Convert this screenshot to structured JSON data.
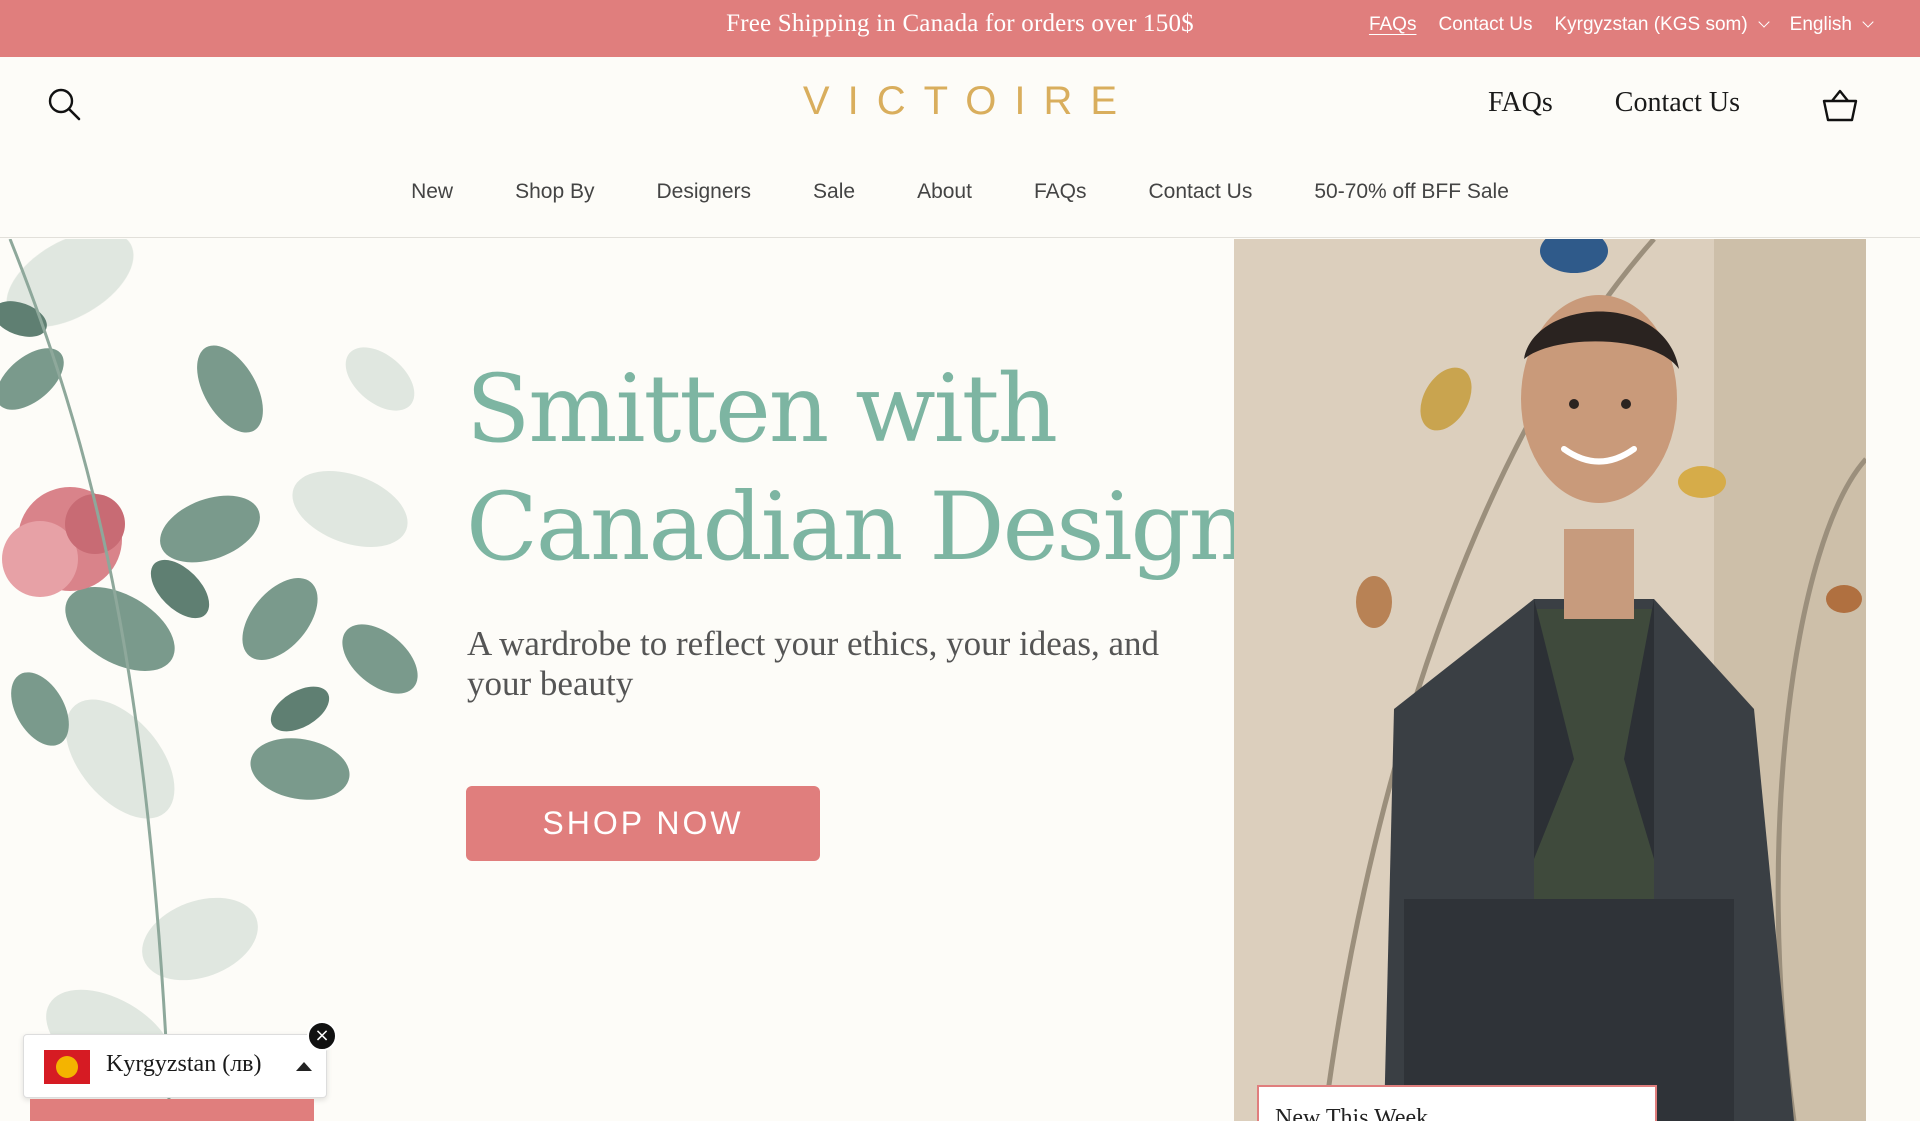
{
  "announcement": {
    "text": "Free Shipping in Canada for orders over 150$",
    "links": {
      "faqs": "FAQs",
      "contact": "Contact Us",
      "currency": "Kyrgyzstan (KGS som)",
      "language": "English"
    }
  },
  "header": {
    "logo": "VICTOIRE",
    "links": {
      "faqs": "FAQs",
      "contact": "Contact Us"
    },
    "icons": {
      "search": "search-icon",
      "cart": "basket-icon"
    }
  },
  "nav": {
    "items": [
      "New",
      "Shop By",
      "Designers",
      "Sale",
      "About",
      "FAQs",
      "Contact Us",
      "50-70% off BFF Sale"
    ]
  },
  "hero": {
    "headline_line1": "Smitten with",
    "headline_line2": "Canadian Design",
    "subline": "A wardrobe to reflect your ethics, your ideas, and your beauty",
    "cta": "SHOP NOW",
    "card_label": "New This Week"
  },
  "country_selector": {
    "label": "Kyrgyzstan (лв)",
    "close": "×"
  },
  "colors": {
    "accent_pink": "#e07e7d",
    "headline_teal": "#7db5a2",
    "logo_gold": "#d9ae5d",
    "background": "#fdfcf8"
  }
}
